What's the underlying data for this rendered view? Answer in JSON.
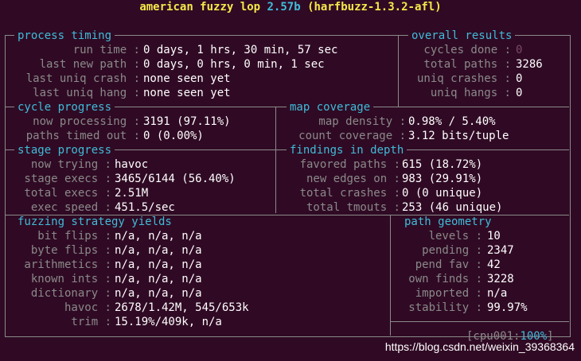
{
  "header": {
    "app": "american fuzzy lop",
    "version": "2.57b",
    "target": "(harfbuzz-1.3.2-afl)"
  },
  "process_timing": {
    "title": "process timing",
    "rows": [
      {
        "label": "run time :",
        "value": "0 days, 1 hrs, 30 min, 57 sec"
      },
      {
        "label": "last new path :",
        "value": "0 days, 0 hrs, 0 min, 1 sec"
      },
      {
        "label": "last uniq crash :",
        "value": "none seen yet"
      },
      {
        "label": "last uniq hang :",
        "value": "none seen yet"
      }
    ]
  },
  "overall_results": {
    "title": "overall results",
    "rows": [
      {
        "label": "cycles done :",
        "value": "0"
      },
      {
        "label": "total paths :",
        "value": "3286"
      },
      {
        "label": "uniq crashes :",
        "value": "0"
      },
      {
        "label": "uniq hangs :",
        "value": "0"
      }
    ]
  },
  "cycle_progress": {
    "title": "cycle progress",
    "rows": [
      {
        "label": "now processing :",
        "value": "3191 (97.11%)"
      },
      {
        "label": "paths timed out :",
        "value": "0 (0.00%)"
      }
    ]
  },
  "map_coverage": {
    "title": "map coverage",
    "rows": [
      {
        "label": "map density :",
        "value": "0.98% / 5.40%"
      },
      {
        "label": "count coverage :",
        "value": "3.12 bits/tuple"
      }
    ]
  },
  "stage_progress": {
    "title": "stage progress",
    "rows": [
      {
        "label": "now trying :",
        "value": "havoc"
      },
      {
        "label": "stage execs :",
        "value": "3465/6144 (56.40%)"
      },
      {
        "label": "total execs :",
        "value": "2.51M"
      },
      {
        "label": "exec speed :",
        "value": "451.5/sec"
      }
    ]
  },
  "findings_in_depth": {
    "title": "findings in depth",
    "rows": [
      {
        "label": "favored paths :",
        "value": "615 (18.72%)"
      },
      {
        "label": "new edges on :",
        "value": "983 (29.91%)"
      },
      {
        "label": "total crashes :",
        "value": "0 (0 unique)"
      },
      {
        "label": "total tmouts :",
        "value": "253 (46 unique)"
      }
    ]
  },
  "fuzzing_strategy_yields": {
    "title": "fuzzing strategy yields",
    "rows": [
      {
        "label": "bit flips :",
        "value": "n/a, n/a, n/a"
      },
      {
        "label": "byte flips :",
        "value": "n/a, n/a, n/a"
      },
      {
        "label": "arithmetics :",
        "value": "n/a, n/a, n/a"
      },
      {
        "label": "known ints :",
        "value": "n/a, n/a, n/a"
      },
      {
        "label": "dictionary :",
        "value": "n/a, n/a, n/a"
      },
      {
        "label": "havoc :",
        "value": "2678/1.42M, 545/653k"
      },
      {
        "label": "trim :",
        "value": "15.19%/409k, n/a"
      }
    ]
  },
  "path_geometry": {
    "title": "path geometry",
    "rows": [
      {
        "label": "levels :",
        "value": "10"
      },
      {
        "label": "pending :",
        "value": "2347"
      },
      {
        "label": "pend fav :",
        "value": "42"
      },
      {
        "label": "own finds :",
        "value": "3228"
      },
      {
        "label": "imported :",
        "value": "n/a"
      },
      {
        "label": "stability :",
        "value": "99.97%"
      }
    ]
  },
  "cpu_status": {
    "prefix": "[cpu001:",
    "percent": "100%",
    "suffix": "]"
  },
  "watermark": "https://blog.csdn.net/weixin_39368364",
  "colors": {
    "background": "#300a24",
    "section": "#3fbcd9",
    "label": "#8a8a8a",
    "header": "#f5e84a"
  }
}
